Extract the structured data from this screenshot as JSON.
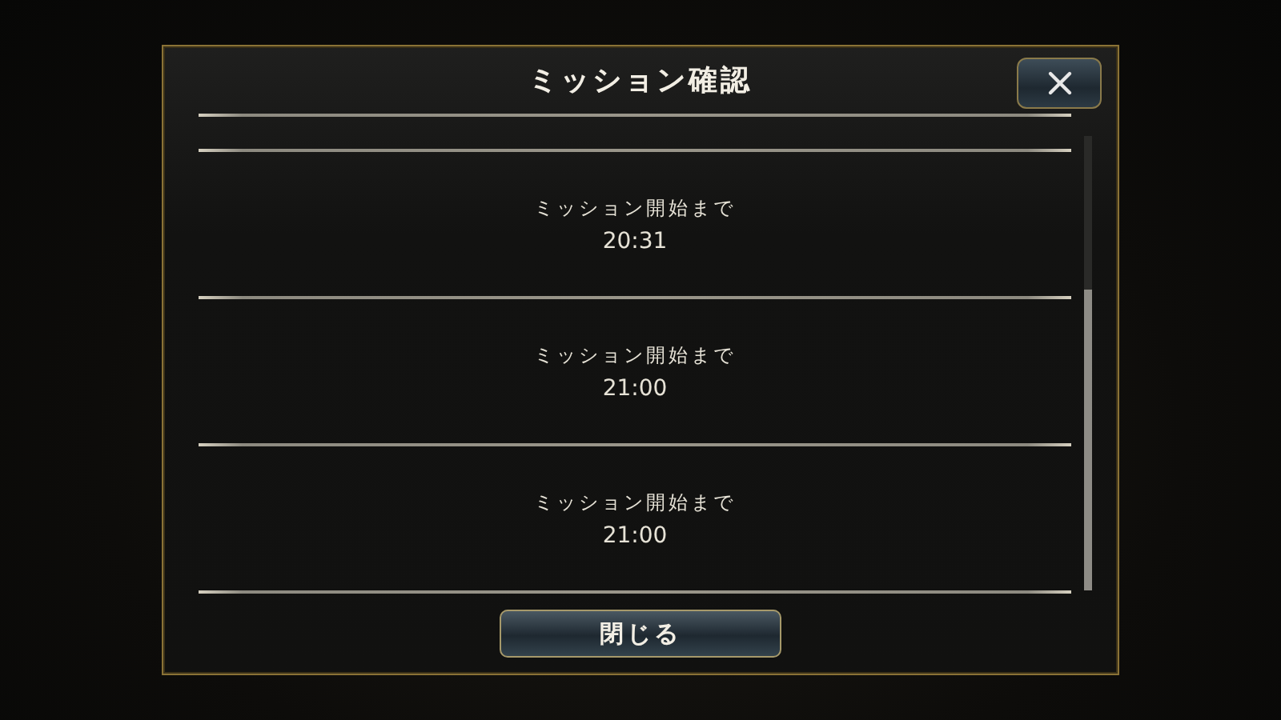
{
  "dialog": {
    "title": "ミッション確認",
    "missions": [
      {
        "label": "ミッション開始まで",
        "time": "20:31"
      },
      {
        "label": "ミッション開始まで",
        "time": "21:00"
      },
      {
        "label": "ミッション開始まで",
        "time": "21:00"
      }
    ],
    "footer_button": "閉じる"
  }
}
